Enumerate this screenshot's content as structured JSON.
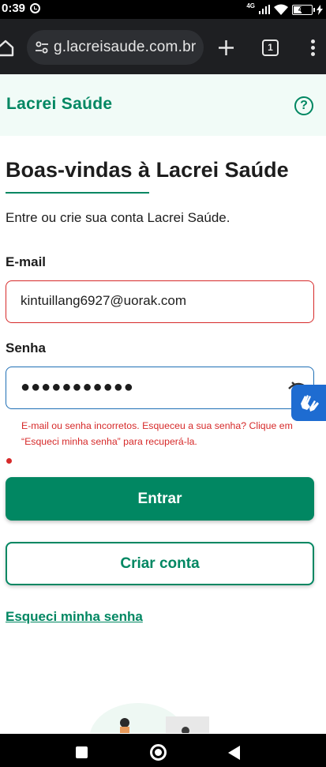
{
  "status_bar": {
    "time": "0:39",
    "network": "4G",
    "battery": "43",
    "battery_level": 0.43
  },
  "browser": {
    "url": "g.lacreisaude.com.br",
    "tab_count": "1"
  },
  "header": {
    "logo": "Lacrei Saúde",
    "help_icon": "help-circle-icon",
    "help_symbol": "?"
  },
  "page": {
    "title": "Boas-vindas à Lacrei Saúde",
    "intro": "Entre ou crie sua conta Lacrei Saúde."
  },
  "form": {
    "email_label": "E-mail",
    "email_value": "kintuillang6927@uorak.com",
    "password_label": "Senha",
    "password_value": "●●●●●●●●●●●",
    "error_message": "E-mail ou senha incorretos. Esqueceu a sua senha? Clique em “Esqueci minha senha” para recuperá-la.",
    "login_button": "Entrar",
    "create_account_button": "Criar conta",
    "forgot_link": "Esqueci minha senha"
  },
  "colors": {
    "brand": "#018762",
    "error": "#d62a2a",
    "focus": "#1f6fb5",
    "accessibility_widget": "#1e6cd1"
  }
}
